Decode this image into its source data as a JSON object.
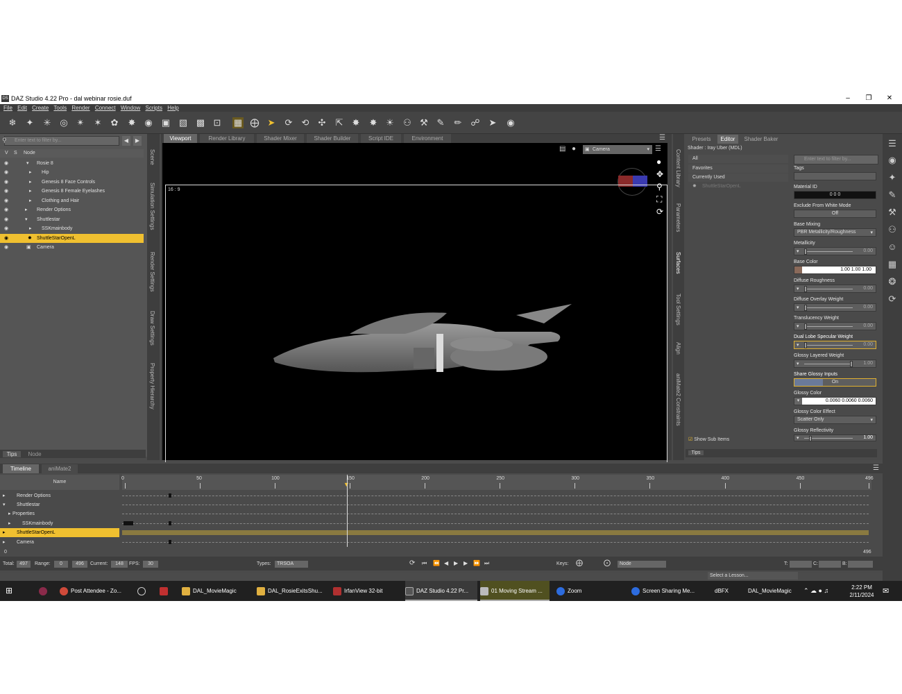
{
  "window": {
    "title": "DAZ Studio 4.22 Pro - dal webinar rosie.duf",
    "ds_badge": "DS"
  },
  "menu": [
    "File",
    "Edit",
    "Create",
    "Tools",
    "Render",
    "Connect",
    "Window",
    "Scripts",
    "Help"
  ],
  "scene": {
    "search_placeholder": "Enter text to filter by...",
    "col_v": "V",
    "col_s": "S",
    "col_node": "Node",
    "items": [
      {
        "label": "Rosie 8"
      },
      {
        "label": "Hip"
      },
      {
        "label": "Genesis 8 Face Controls"
      },
      {
        "label": "Genesis 8 Female Eyelashes"
      },
      {
        "label": "Clothing and Hair"
      },
      {
        "label": "Render Options"
      },
      {
        "label": "Shuttlestar"
      },
      {
        "label": "SSKmainbody"
      },
      {
        "label": "ShuttleStarOpenL"
      },
      {
        "label": "Camera"
      }
    ],
    "bottom_tabs": [
      "Tips",
      "Node"
    ]
  },
  "left_side_tabs": [
    "Scene",
    "Simulation Settings",
    "Render Settings",
    "Draw Settings",
    "Property Hierarchy"
  ],
  "viewport": {
    "tabs": [
      "Viewport",
      "Render Library",
      "Shader Mixer",
      "Shader Builder",
      "Script IDE",
      "Environment"
    ],
    "camera": "Camera",
    "aspect": "16 : 9"
  },
  "middle_side_tabs": [
    "Content Library",
    "Parameters",
    "Surfaces",
    "Tool Settings",
    "Align",
    "aniMate2 Constraints"
  ],
  "surfaces": {
    "tabs": [
      "Presets",
      "Editor",
      "Shader Baker"
    ],
    "shader": "Shader : Iray Uber (MDL)",
    "filters": [
      "All",
      "Favorites",
      "Currently Used"
    ],
    "tree_item": "ShuttleStarOpenL",
    "search_placeholder": "Enter text to filter by...",
    "show_sub_items": "Show Sub Items",
    "tips": "Tips",
    "props": [
      {
        "label": "Tags",
        "value": ""
      },
      {
        "label": "Material ID",
        "value": "0  0  0"
      },
      {
        "label": "Exclude From White Mode",
        "value": "Off"
      },
      {
        "label": "Base Mixing",
        "value": "PBR Metallicity/Roughness"
      },
      {
        "label": "Metallicity",
        "value": "0.00",
        "level": 0.0
      },
      {
        "label": "Base Color",
        "value": "1.00  1.00  1.00"
      },
      {
        "label": "Diffuse Roughness",
        "value": "0.00",
        "level": 0.0
      },
      {
        "label": "Diffuse Overlay Weight",
        "value": "0.00",
        "level": 0.0
      },
      {
        "label": "Translucency Weight",
        "value": "0.00",
        "level": 0.0
      },
      {
        "label": "Dual Lobe Specular Weight",
        "value": "0.00",
        "level": 0.0
      },
      {
        "label": "Glossy Layered Weight",
        "value": "1.00",
        "level": 1.0
      },
      {
        "label": "Share Glossy Inputs",
        "value": "On"
      },
      {
        "label": "Glossy Color",
        "value": "0.0060  0.0060  0.0060"
      },
      {
        "label": "Glossy Color Effect",
        "value": "Scatter Only"
      },
      {
        "label": "Glossy Reflectivity",
        "value": "1.00",
        "level": 0.1
      }
    ]
  },
  "timeline": {
    "tabs": [
      "Timeline",
      "aniMate2"
    ],
    "name_header": "Name",
    "ticks": [
      "0",
      "50",
      "100",
      "150",
      "200",
      "250",
      "300",
      "350",
      "400",
      "450",
      "496"
    ],
    "rows": [
      {
        "label": "Render Options"
      },
      {
        "label": "Shuttlestar"
      },
      {
        "label": "Properties"
      },
      {
        "label": "SSKmainbody"
      },
      {
        "label": "ShuttleStarOpenL"
      },
      {
        "label": "Camera"
      }
    ],
    "start": "0",
    "end": "496",
    "current_frame": 148
  },
  "status": {
    "total_label": "Total:",
    "total": "497",
    "range_label": "Range:",
    "range_start": "0",
    "range_end": "496",
    "current_label": "Current:",
    "current": "148",
    "fps_label": "FPS:",
    "fps": "30",
    "types_label": "Types:",
    "types": "TRSOA",
    "keys_label": "Keys:",
    "node": "Node",
    "t_label": "T:",
    "c_label": "C:",
    "b_label": "B:",
    "lesson": "Select a Lesson..."
  },
  "taskbar": {
    "items": [
      "Post Attendee - Zo...",
      "DAL_MovieMagic",
      "DAL_RosieExitsShu...",
      "IrfanView 32-bit",
      "DAZ Studio 4.22 Pr...",
      "01 Moving Stream ...",
      "Zoom",
      "Screen Sharing Me...",
      "dBFX",
      "DAL_MovieMagic"
    ],
    "time": "2:22 PM",
    "date": "2/11/2024"
  }
}
